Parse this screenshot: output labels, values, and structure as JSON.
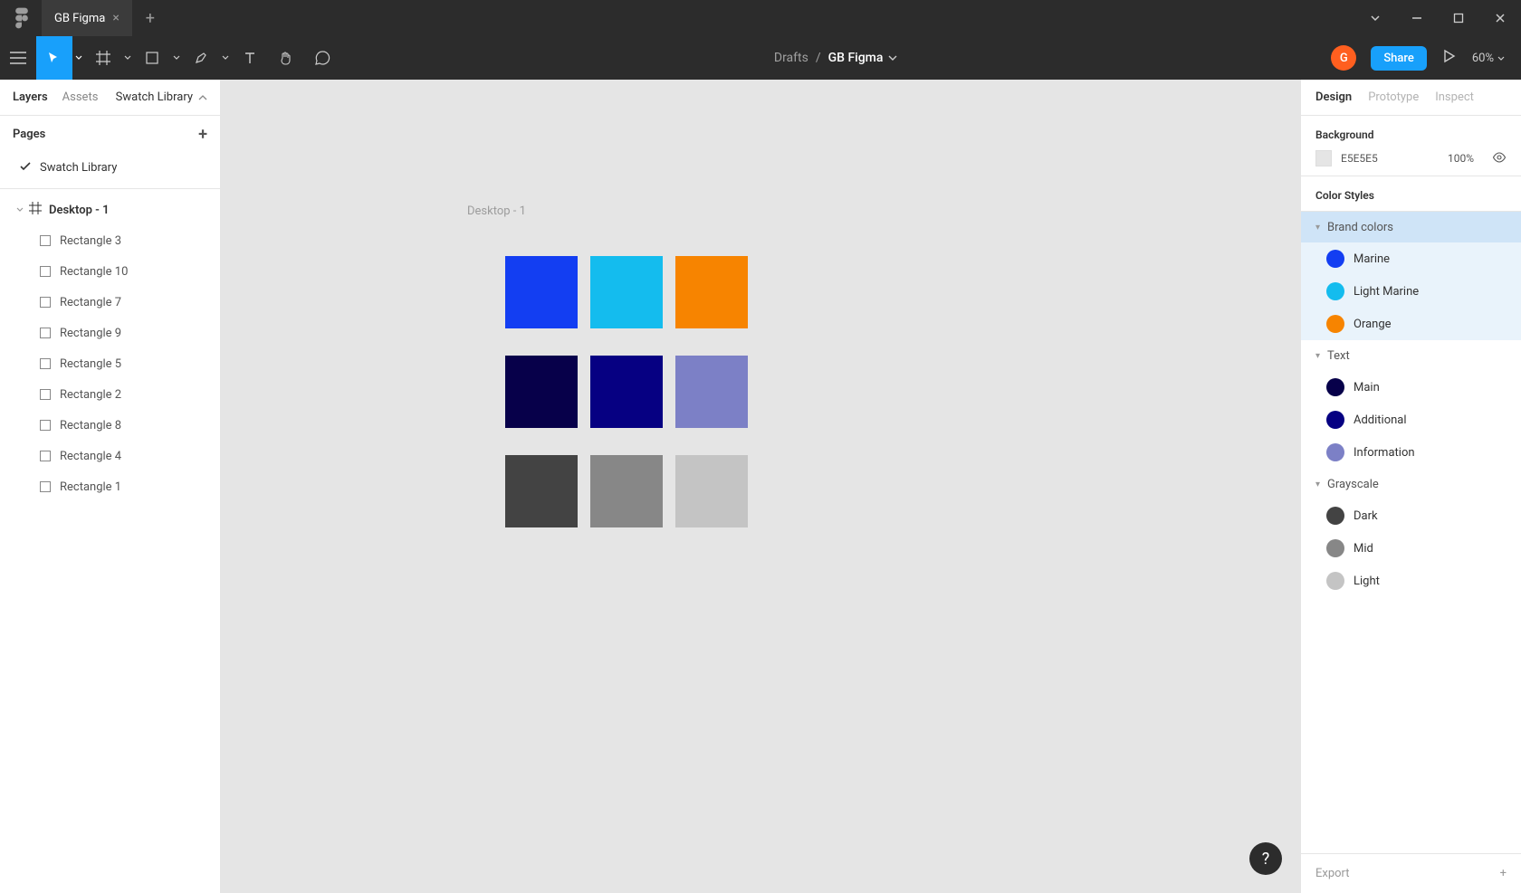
{
  "titlebar": {
    "tab_name": "GB Figma"
  },
  "toolbar": {
    "breadcrumb_root": "Drafts",
    "breadcrumb_file": "GB Figma",
    "avatar_letter": "G",
    "share_label": "Share",
    "zoom": "60%"
  },
  "left_panel": {
    "tabs": {
      "layers": "Layers",
      "assets": "Assets",
      "page_selector": "Swatch Library"
    },
    "pages_header": "Pages",
    "pages": [
      {
        "name": "Swatch Library",
        "active": true
      }
    ],
    "frame": "Desktop - 1",
    "layers": [
      "Rectangle 3",
      "Rectangle 10",
      "Rectangle 7",
      "Rectangle 9",
      "Rectangle 5",
      "Rectangle 2",
      "Rectangle 8",
      "Rectangle 4",
      "Rectangle 1"
    ]
  },
  "canvas": {
    "frame_label": "Desktop - 1",
    "swatches": [
      "#133ef2",
      "#14bcee",
      "#f78400",
      "#07004a",
      "#060082",
      "#7c80c6",
      "#434343",
      "#878787",
      "#c4c4c4"
    ]
  },
  "right_panel": {
    "tabs": {
      "design": "Design",
      "prototype": "Prototype",
      "inspect": "Inspect"
    },
    "background": {
      "title": "Background",
      "hex": "E5E5E5",
      "opacity": "100%"
    },
    "color_styles_title": "Color Styles",
    "groups": [
      {
        "name": "Brand colors",
        "highlighted": true,
        "colors": [
          {
            "name": "Marine",
            "hex": "#133ef2"
          },
          {
            "name": "Light Marine",
            "hex": "#14bcee"
          },
          {
            "name": "Orange",
            "hex": "#f78400"
          }
        ]
      },
      {
        "name": "Text",
        "highlighted": false,
        "colors": [
          {
            "name": "Main",
            "hex": "#07004a"
          },
          {
            "name": "Additional",
            "hex": "#060082"
          },
          {
            "name": "Information",
            "hex": "#7c80c6"
          }
        ]
      },
      {
        "name": "Grayscale",
        "highlighted": false,
        "colors": [
          {
            "name": "Dark",
            "hex": "#434343"
          },
          {
            "name": "Mid",
            "hex": "#878787"
          },
          {
            "name": "Light",
            "hex": "#c4c4c4"
          }
        ]
      }
    ],
    "export_label": "Export"
  }
}
